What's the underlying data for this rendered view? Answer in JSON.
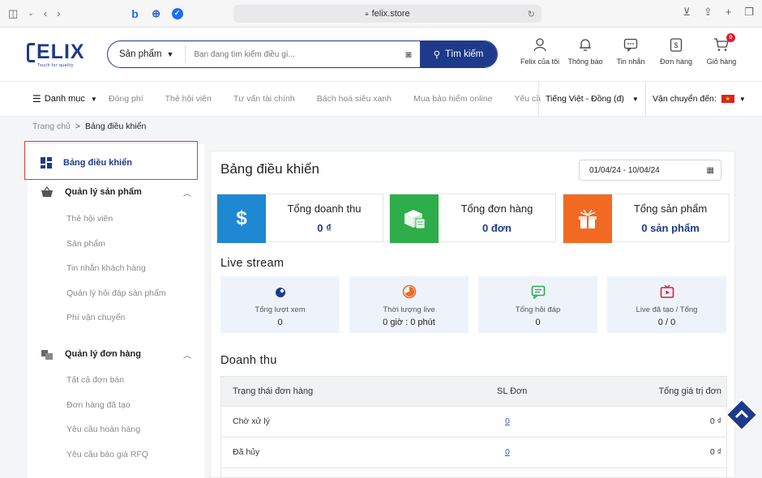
{
  "browser": {
    "url": "felix.store",
    "lock": "🔒"
  },
  "logo": {
    "text": "ELIX",
    "tagline": "Touch for quality"
  },
  "search": {
    "category": "Sản phẩm",
    "placeholder": "Bạn đang tìm kiếm điều gì...",
    "button": "Tìm kiếm"
  },
  "header_icons": [
    {
      "label": "Felix của tôi",
      "icon": "user-icon"
    },
    {
      "label": "Thông báo",
      "icon": "bell-icon"
    },
    {
      "label": "Tin nhắn",
      "icon": "message-icon"
    },
    {
      "label": "Đơn hàng",
      "icon": "order-icon"
    },
    {
      "label": "Giỏ hàng",
      "icon": "cart-icon",
      "badge": "0"
    }
  ],
  "nav": {
    "category": "Danh mục",
    "links": [
      "Đóng phí",
      "Thẻ hội viên",
      "Tư vấn tài chính",
      "Bách hoá siêu xanh",
      "Mua bảo hiểm online",
      "Yêu cầ"
    ],
    "language": "Tiếng Việt - Đồng (đ)",
    "shipping": "Vận chuyển đến:"
  },
  "breadcrumb": {
    "home": "Trang chủ",
    "sep": ">",
    "current": "Bảng điều khiển"
  },
  "sidebar": {
    "active": "Bảng điều khiển",
    "sections": [
      {
        "title": "Quản lý sản phẩm",
        "items": [
          "Thẻ hội viên",
          "Sản phẩm",
          "Tin nhắn khách hàng",
          "Quản lý hỏi đáp sản phẩm",
          "Phí vận chuyển"
        ]
      },
      {
        "title": "Quản lý đơn hàng",
        "items": [
          "Tất cả đơn bán",
          "Đơn hàng đã tạo",
          "Yêu cầu hoàn hàng",
          "Yêu cầu báo giá RFQ"
        ]
      }
    ]
  },
  "main": {
    "title": "Bảng điều khiển",
    "date_range": "01/04/24 - 10/04/24",
    "stats": [
      {
        "title": "Tổng doanh thu",
        "value": "0 ₫",
        "color": "#1e88d2"
      },
      {
        "title": "Tổng đơn hàng",
        "value": "0 đơn",
        "color": "#2eae4a"
      },
      {
        "title": "Tổng sản phẩm",
        "value": "0 sản phẩm",
        "color": "#f26a22"
      }
    ],
    "live_title": "Live stream",
    "live": [
      {
        "label": "Tổng lượt xem",
        "value": "0"
      },
      {
        "label": "Thời lượng live",
        "value": "0 giờ : 0 phút"
      },
      {
        "label": "Tổng hỏi đáp",
        "value": "0"
      },
      {
        "label": "Live đã tạo / Tổng",
        "value": "0 / 0"
      }
    ],
    "revenue_title": "Doanh thu",
    "table": {
      "headers": [
        "Trạng thái đơn hàng",
        "SL Đơn",
        "Tổng giá trị đơn"
      ],
      "rows": [
        {
          "status": "Chờ xử lý",
          "count": "0",
          "value": "0 ₫"
        },
        {
          "status": "Đã hủy",
          "count": "0",
          "value": "0 ₫"
        }
      ]
    }
  }
}
